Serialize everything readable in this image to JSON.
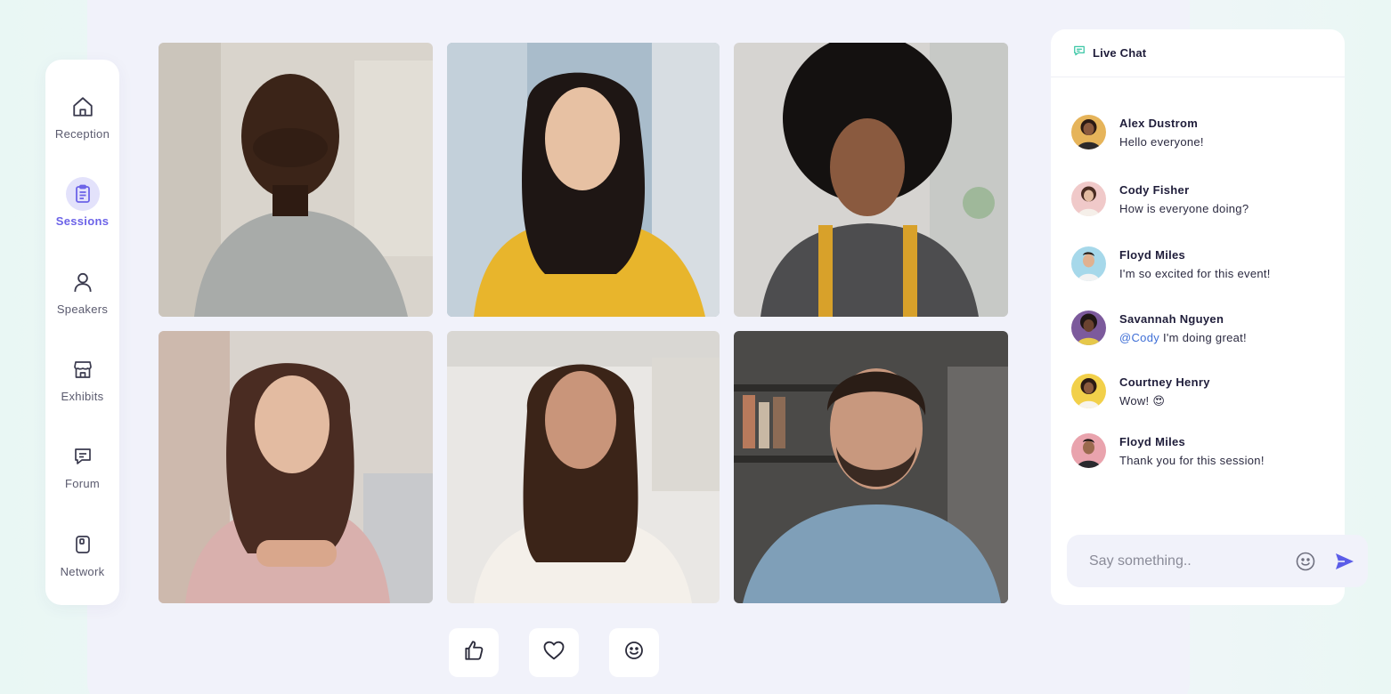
{
  "sidebar": {
    "items": [
      {
        "label": "Reception",
        "icon": "home-icon"
      },
      {
        "label": "Sessions",
        "icon": "clipboard-icon",
        "active": true
      },
      {
        "label": "Speakers",
        "icon": "person-icon"
      },
      {
        "label": "Exhibits",
        "icon": "store-icon"
      },
      {
        "label": "Forum",
        "icon": "chat-bubble-icon"
      },
      {
        "label": "Network",
        "icon": "phone-card-icon"
      }
    ]
  },
  "participants": [
    {
      "name": "participant-1"
    },
    {
      "name": "participant-2"
    },
    {
      "name": "participant-3"
    },
    {
      "name": "participant-4"
    },
    {
      "name": "participant-5"
    },
    {
      "name": "participant-6"
    }
  ],
  "reactions": [
    "thumbs-up-icon",
    "heart-icon",
    "smiley-icon"
  ],
  "chat": {
    "title": "Live Chat",
    "messages": [
      {
        "name": "Alex Dustrom",
        "text": "Hello everyone!"
      },
      {
        "name": "Cody Fisher",
        "text": "How is everyone doing?"
      },
      {
        "name": "Floyd Miles",
        "text": "I'm so excited for this event!"
      },
      {
        "name": "Savannah Nguyen",
        "mention": "@Cody",
        "text": " I'm doing great!"
      },
      {
        "name": "Courtney Henry",
        "text": "Wow! 😍"
      },
      {
        "name": "Floyd Miles",
        "text": "Thank you for this session!"
      }
    ],
    "input_placeholder": "Say something.."
  },
  "colors": {
    "accent": "#6c63e8",
    "send": "#5b5de8",
    "mention": "#3f6fd6",
    "chat_icon": "#3cc7a6"
  }
}
